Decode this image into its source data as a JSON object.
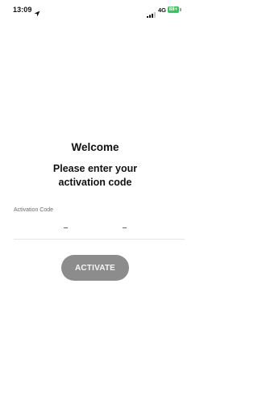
{
  "status_bar": {
    "time": "13:09",
    "network": "4G",
    "battery": "88+",
    "location_icon": "location-arrow-icon",
    "signal_icon": "cellular-signal-icon"
  },
  "main": {
    "welcome": "Welcome",
    "prompt": "Please enter your activation code",
    "activation_label": "Activation Code",
    "activate_label": "ACTIVATE"
  },
  "colors": {
    "button_bg": "#8c8c8c",
    "battery_green": "#34c759"
  }
}
